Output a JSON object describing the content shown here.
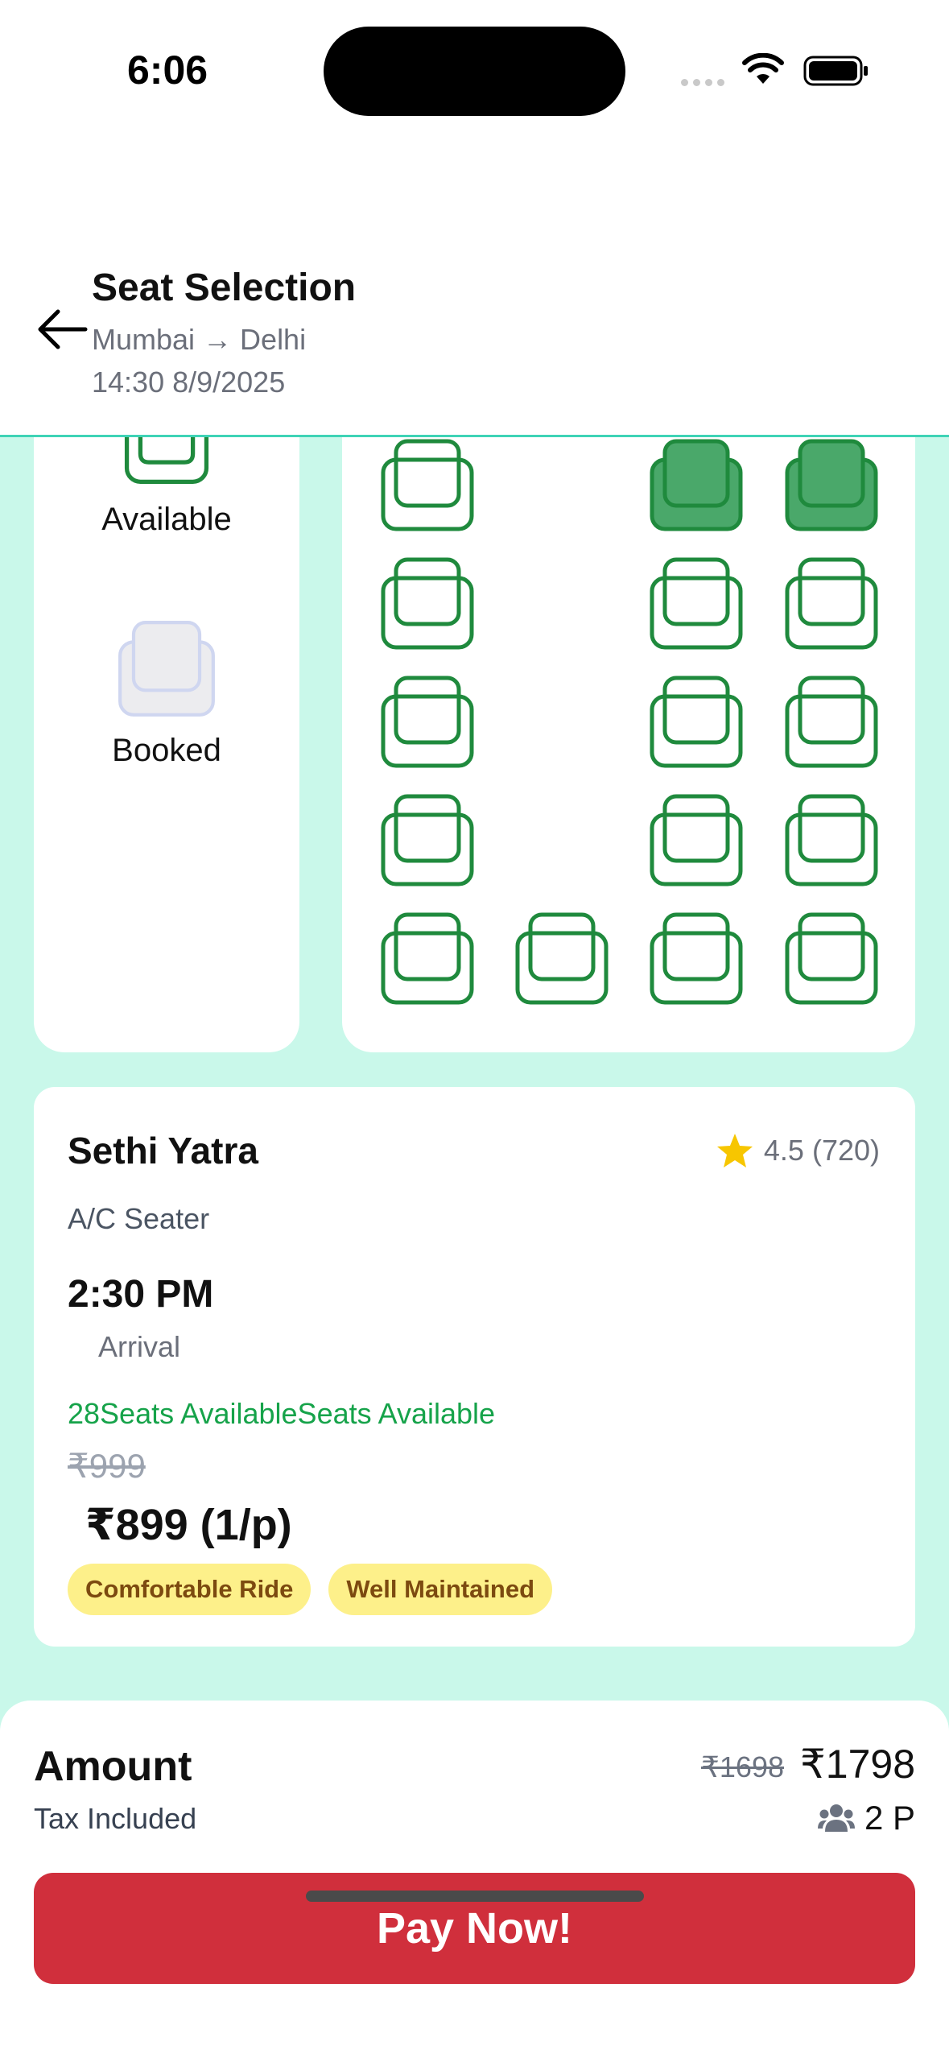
{
  "status_bar": {
    "time": "6:06"
  },
  "header": {
    "title": "Seat Selection",
    "route": "Mumbai → Delhi",
    "datetime": "14:30 8/9/2025"
  },
  "legend": {
    "available_label": "Available",
    "booked_label": "Booked"
  },
  "seat_map": {
    "seat_color": "#1f8a3d",
    "selected_fill": "#4aa86a",
    "booked_fill": "#ececef",
    "booked_stroke": "#cfd6f0",
    "rows": [
      [
        "available",
        null,
        "selected",
        "selected"
      ],
      [
        "available",
        null,
        "available",
        "available"
      ],
      [
        "available",
        null,
        "available",
        "available"
      ],
      [
        "available",
        null,
        "available",
        "available"
      ],
      [
        "available",
        "available",
        "available",
        "available"
      ]
    ]
  },
  "bus": {
    "operator": "Sethi Yatra",
    "rating": "4.5 (720)",
    "type": "A/C Seater",
    "departure": "2:30 PM",
    "arrival_label": "Arrival",
    "seats_available": "28Seats AvailableSeats Available",
    "old_price": "₹999",
    "price": "₹899 (1/p)",
    "tags": [
      "Comfortable Ride",
      "Well Maintained"
    ]
  },
  "summary": {
    "amount_label": "Amount",
    "tax_label": "Tax Included",
    "old_amount": "₹1698",
    "amount": "₹1798",
    "passengers": "2 P",
    "pay_button": "Pay Now!"
  },
  "colors": {
    "accent_red": "#d02f3c",
    "background_mint": "#c9f8ea",
    "divider_teal": "#3fd3b6"
  }
}
